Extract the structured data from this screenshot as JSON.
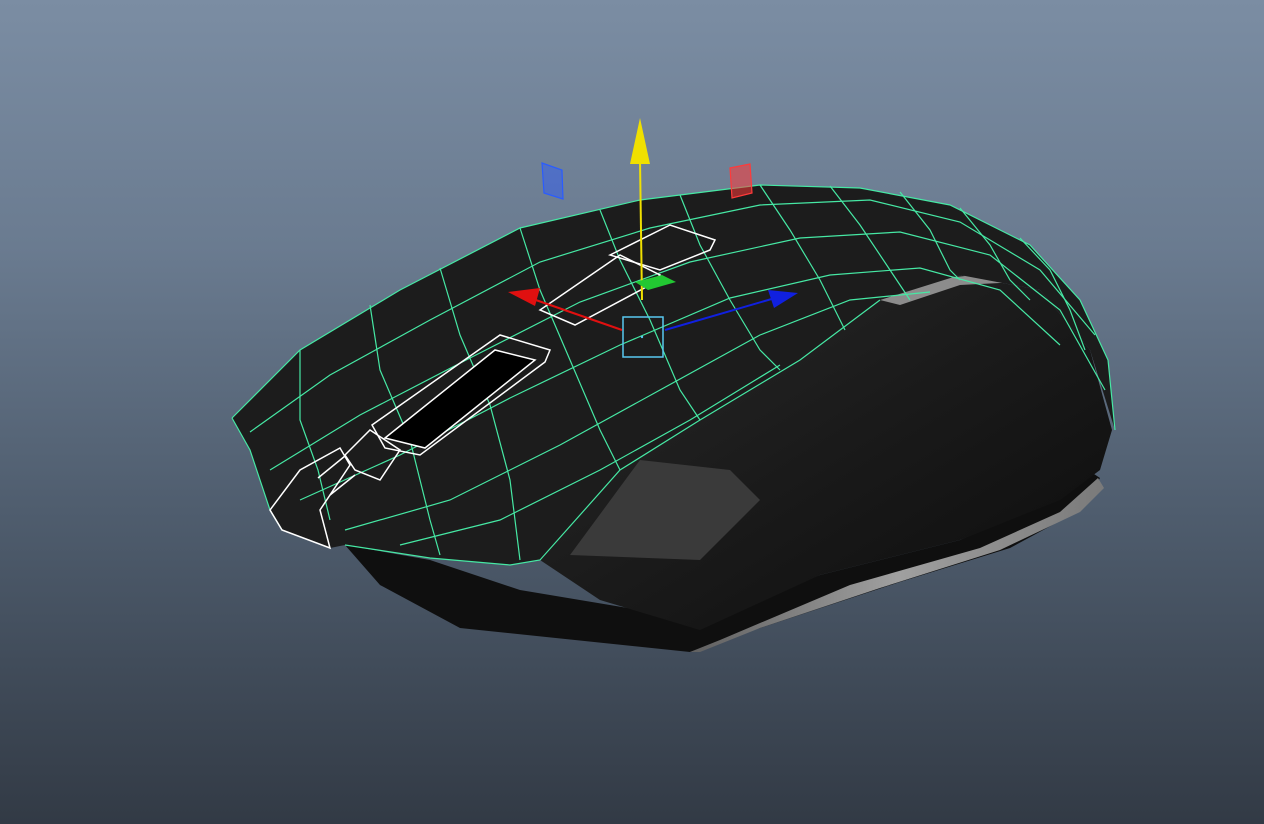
{
  "viewport": {
    "background_top": "#7b8da3",
    "background_bottom": "#323a45"
  },
  "mouse_model": {
    "body_color": "#161616",
    "side_color": "#2a2a2a",
    "rim_color": "#9a9a9a",
    "wireframe_color": "#46e8a4",
    "selected_edges_color": "#ffffff"
  },
  "manipulator": {
    "type": "move-tool",
    "x_axis_color": "#e01010",
    "y_axis_color": "#f0e000",
    "z_axis_color": "#1020e0",
    "center_color": "#58c8f0",
    "plane_handle_colors": [
      "#2a5cff",
      "#ff3a3a",
      "#22c832"
    ]
  }
}
